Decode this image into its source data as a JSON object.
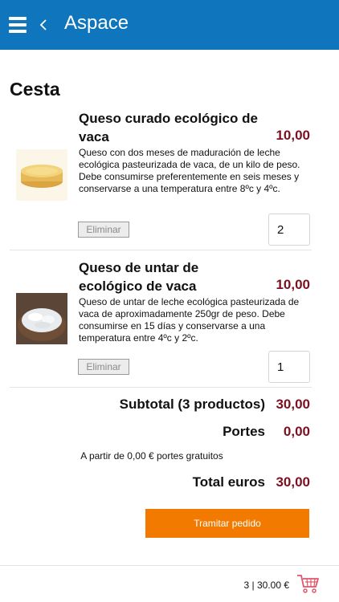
{
  "app": {
    "title": "Aspace",
    "menu_icon": "hamburger-menu-icon",
    "back_icon": "chevron-left-icon"
  },
  "page": {
    "title": "Cesta"
  },
  "cart_items": [
    {
      "name": "Queso curado ecológico de vaca",
      "price": "10,00",
      "description": "Queso con dos meses de maduración de leche ecológica pasteurizada de vaca, de un kilo de peso. Debe consumirse preferentemente en seis meses y conservarse a una temperatura entre 8ºc y 4ºc.",
      "remove_label": "Eliminar",
      "quantity": "2",
      "image": "cheese-wheel-image"
    },
    {
      "name": "Queso de untar de ecológico de vaca",
      "price": "10,00",
      "description": "Queso de untar de leche ecológica pasteurizada de vaca de aproximadamente 250gr de peso. Debe consumirse en 15 días y conservarse a una temperatura entre 4ºc y 2ºc.",
      "remove_label": "Eliminar",
      "quantity": "1",
      "image": "cream-cheese-bowl-image"
    }
  ],
  "summary": {
    "subtotal_label": "Subtotal (3 productos)",
    "subtotal_value": "30,00",
    "shipping_label": "Portes",
    "shipping_value": "0,00",
    "free_shipping_note": "A partir de 0,00 € portes gratuitos",
    "total_label": "Total euros",
    "total_value": "30,00"
  },
  "actions": {
    "checkout_label": "Tramitar pedido"
  },
  "footer": {
    "cart_summary": "3 | 30.00 €",
    "cart_icon": "shopping-cart-icon"
  },
  "colors": {
    "header_bg": "#0f75bd",
    "price": "#7a1020",
    "checkout_bg": "#f27a00"
  }
}
